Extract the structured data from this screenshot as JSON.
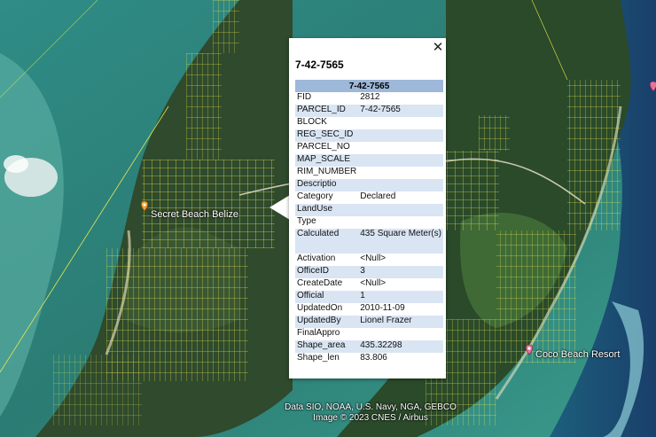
{
  "map": {
    "places": [
      {
        "name": "Secret Beach Belize",
        "color": "#f0a030"
      },
      {
        "name": "Coco Beach Resort",
        "color": "#e8709a"
      }
    ],
    "attribution": [
      "Data SIO, NOAA, U.S. Navy, NGA, GEBCO",
      "Image © 2023 CNES / Airbus"
    ],
    "parcel_color": "#e8e84a"
  },
  "popup": {
    "title": "7-42-7565",
    "close_icon": "close-icon",
    "table_header": "7-42-7565",
    "rows": [
      {
        "key": "FID",
        "value": "2812"
      },
      {
        "key": "PARCEL_ID",
        "value": "7-42-7565"
      },
      {
        "key": "BLOCK",
        "value": ""
      },
      {
        "key": "REG_SEC_ID",
        "value": ""
      },
      {
        "key": "PARCEL_NO",
        "value": ""
      },
      {
        "key": "MAP_SCALE",
        "value": ""
      },
      {
        "key": "RIM_NUMBER",
        "value": ""
      },
      {
        "key": "Descriptio",
        "value": ""
      },
      {
        "key": "Category",
        "value": "Declared"
      },
      {
        "key": "LandUse",
        "value": ""
      },
      {
        "key": "Type",
        "value": ""
      },
      {
        "key": "Calculated",
        "value": "435 Square Meter(s)"
      },
      {
        "key": "Activation",
        "value": "<Null>"
      },
      {
        "key": "OfficeID",
        "value": "3"
      },
      {
        "key": "CreateDate",
        "value": "<Null>"
      },
      {
        "key": "Official",
        "value": "1"
      },
      {
        "key": "UpdatedOn",
        "value": "2010-11-09"
      },
      {
        "key": "UpdatedBy",
        "value": "Lionel Frazer"
      },
      {
        "key": "FinalAppro",
        "value": ""
      },
      {
        "key": "Shape_area",
        "value": "435.32298"
      },
      {
        "key": "Shape_len",
        "value": "83.806"
      }
    ]
  }
}
